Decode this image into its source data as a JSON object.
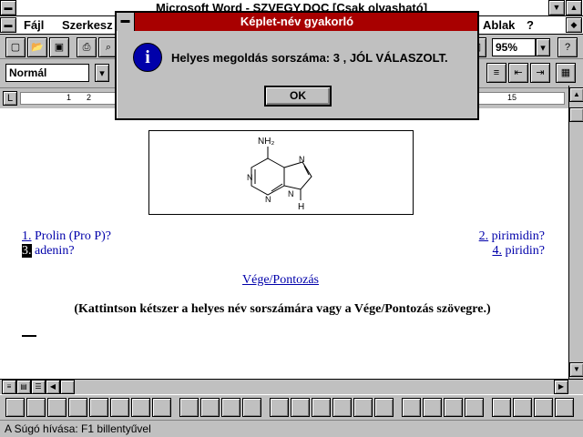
{
  "window": {
    "title": "Microsoft Word - SZVEGY.DOC [Csak olvasható]"
  },
  "menu": {
    "items": [
      "Fájl",
      "Szerkesz",
      "Ablak",
      "?"
    ]
  },
  "toolbar": {
    "zoom": "95%",
    "style": "Normál"
  },
  "ruler": {
    "marks": [
      "1",
      "2",
      "15"
    ]
  },
  "dialog": {
    "title": "Képlet-név gyakorló",
    "message": "Helyes megoldás sorszáma: 3 , JÓL VÁLASZOLT.",
    "ok_label": "OK",
    "icon": "info-icon"
  },
  "structure": {
    "nh2_label": "NH₂",
    "h_label": "H",
    "n_label": "N"
  },
  "answers": [
    {
      "num": "1.",
      "text": "Prolin (Pro P)?"
    },
    {
      "num": "2.",
      "text": "pirimidin?"
    },
    {
      "num": "3.",
      "text": "adenin?"
    },
    {
      "num": "4.",
      "text": "piridin?"
    }
  ],
  "end_link": "Vége/Pontozás",
  "instruction": "(Kattintson kétszer a helyes név sorszámára vagy a Vége/Pontozás szövegre.)",
  "status": {
    "text": "A Súgó hívása: F1 billentyűvel"
  },
  "colors": {
    "dialog_title": "#a80000",
    "link": "#0000aa",
    "info_icon": "#0000aa"
  }
}
